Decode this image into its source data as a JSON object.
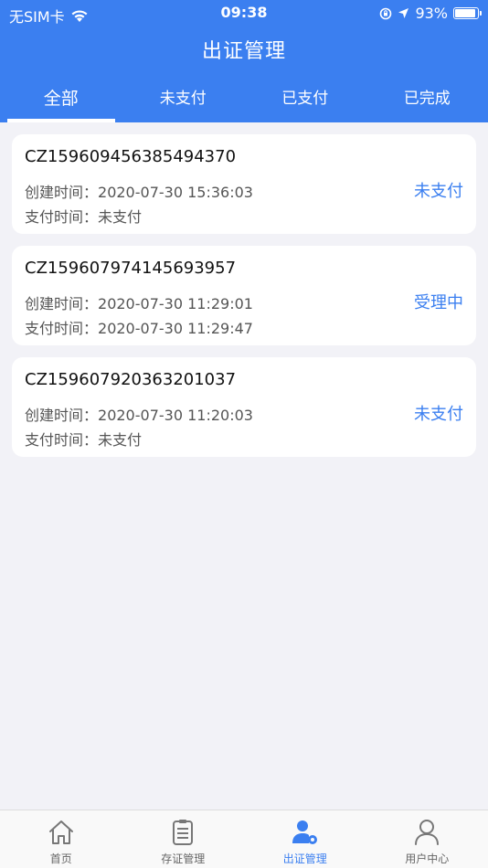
{
  "status_bar": {
    "carrier": "无SIM卡",
    "time": "09:38",
    "battery": "93%",
    "battery_level": 0.93
  },
  "nav": {
    "title": "出证管理"
  },
  "tabs": [
    {
      "label": "全部",
      "active": true
    },
    {
      "label": "未支付",
      "active": false
    },
    {
      "label": "已支付",
      "active": false
    },
    {
      "label": "已完成",
      "active": false
    }
  ],
  "orders": [
    {
      "id": "CZ159609456385494370",
      "created_label": "创建时间：",
      "created": "2020-07-30 15:36:03",
      "paid_label": "支付时间：",
      "paid": "未支付",
      "status": "未支付"
    },
    {
      "id": "CZ159607974145693957",
      "created_label": "创建时间：",
      "created": "2020-07-30 11:29:01",
      "paid_label": "支付时间：",
      "paid": "2020-07-30 11:29:47",
      "status": "受理中"
    },
    {
      "id": "CZ159607920363201037",
      "created_label": "创建时间：",
      "created": "2020-07-30 11:20:03",
      "paid_label": "支付时间：",
      "paid": "未支付",
      "status": "未支付"
    }
  ],
  "tabbar": [
    {
      "label": "首页",
      "icon": "home-icon"
    },
    {
      "label": "存证管理",
      "icon": "clipboard-icon"
    },
    {
      "label": "出证管理",
      "icon": "user-gear-icon",
      "active": true
    },
    {
      "label": "用户中心",
      "icon": "user-icon"
    }
  ],
  "colors": {
    "primary": "#3b7ff0",
    "background": "#f2f2f7"
  }
}
